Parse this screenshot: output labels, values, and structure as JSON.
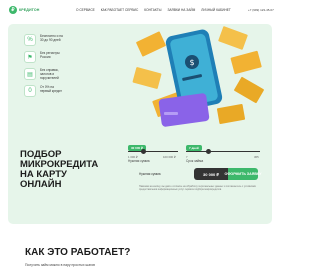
{
  "header": {
    "logo_text": "КРЕДИТОН",
    "nav": [
      "О СЕРВИСЕ",
      "КАК РАБОТАЕТ СЕРВИС",
      "КОНТАКТЫ",
      "ЗАЯВКИ НА ЗАЙМ",
      "ЛИЧНЫЙ КАБИНЕТ"
    ],
    "phone": "+7 (999) 123-45-67"
  },
  "features": [
    {
      "text": "Бесплатно и на 30 до 90 дней",
      "icon": "percent-icon"
    },
    {
      "text": "Без регистры Россия",
      "icon": "flag-icon"
    },
    {
      "text": "Без справок, залогов и поручителей",
      "icon": "document-icon"
    },
    {
      "text": "От 0% на первый кредит",
      "icon": "zero-percent-icon"
    }
  ],
  "hero_title": "ПОДБОР МИКРОКРЕДИТА НА КАРТУ ОНЛАЙН",
  "sliders": {
    "amount": {
      "badge": "30 000 ₽",
      "label": "Нужная сумма",
      "min": "1 000 ₽",
      "max": "100 000 ₽",
      "level": 0.3
    },
    "term": {
      "badge": "7 дней",
      "label": "Срок займа",
      "min": "7",
      "max": "365",
      "level": 0.4
    }
  },
  "result_label": "Нужная сумма",
  "amount_button": "30 000 ₽",
  "apply_button": "ОФОРМИТЬ ЗАЯВКУ",
  "disclaimer": "Нажимая на кнопку, вы даёте согласие на обработку персональных данных и соглашаетесь с условиями предоставления информационных услуг сервиса подбора микрокредитов.",
  "section": {
    "title": "КАК ЭТО РАБОТАЕТ?",
    "subtitle": "Получить займ можно в пару простых шагов"
  },
  "colors": {
    "accent": "#3db86b",
    "hero_bg": "#e6f5ea",
    "dark": "#333333"
  }
}
